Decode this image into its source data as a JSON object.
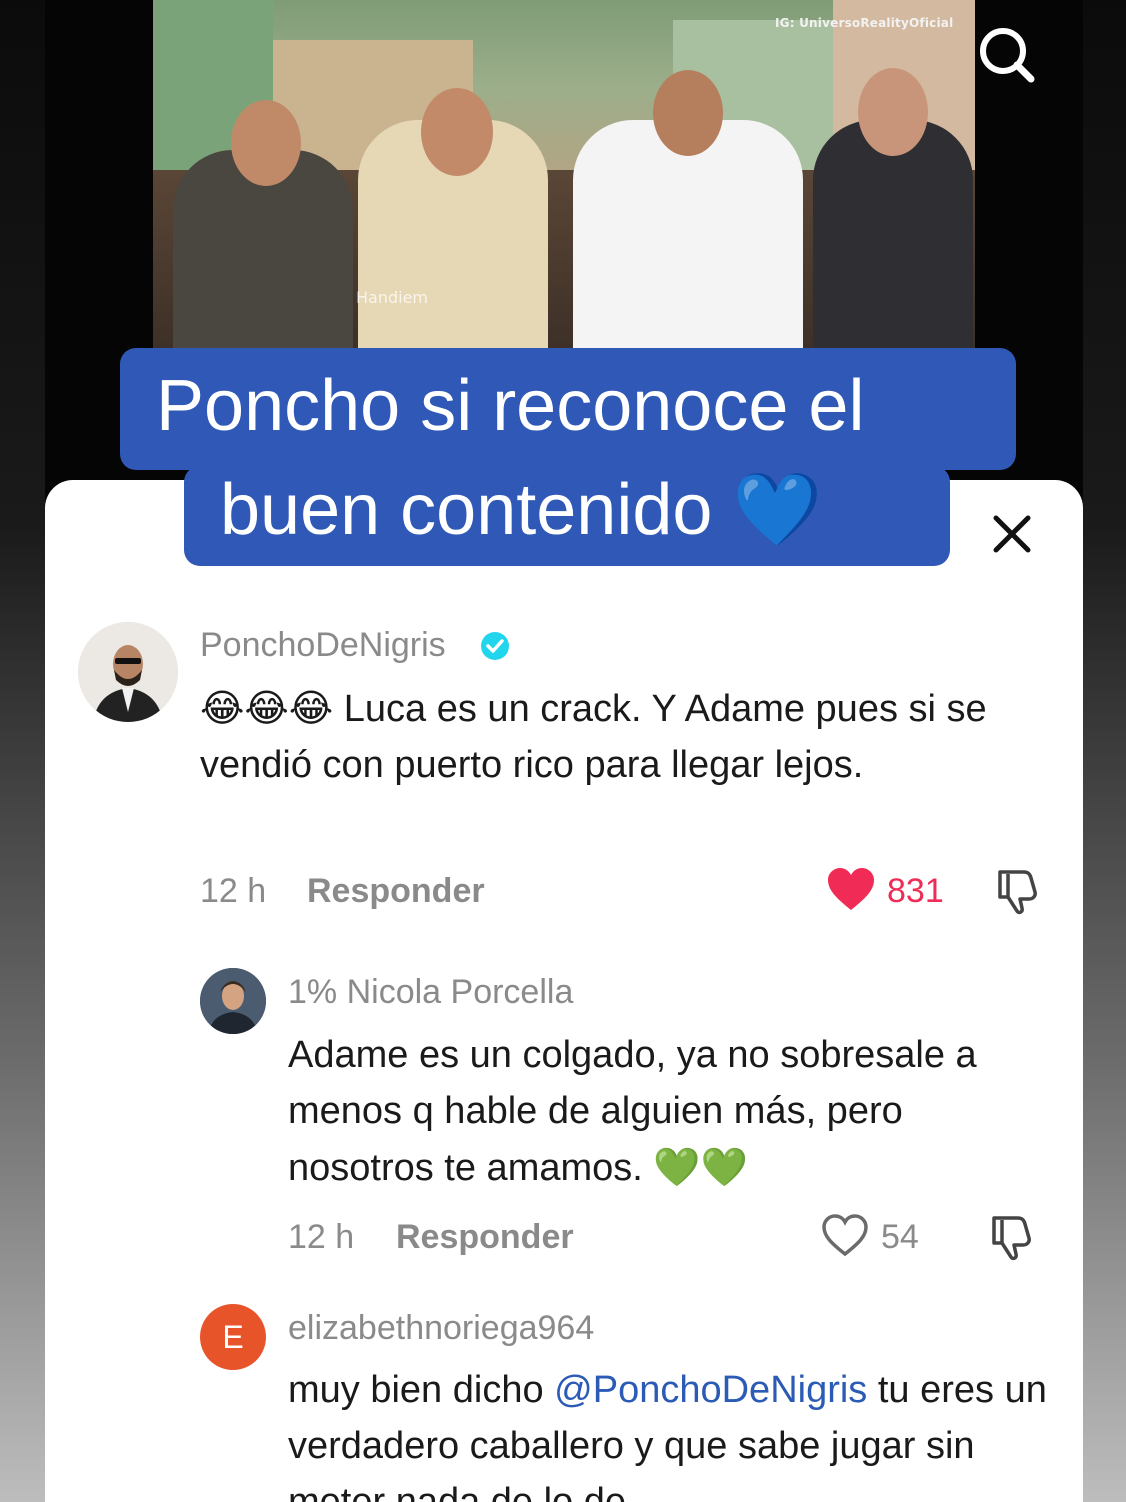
{
  "video": {
    "watermark": "IG: UniversoRealityOficial",
    "overlay_mark": "Handiem",
    "caption_line1": "Poncho si reconoce el",
    "caption_line2": "buen contenido 💙",
    "caption_color": "#2f58b7"
  },
  "icons": {
    "search": "search-icon",
    "close": "close-icon",
    "like": "heart-icon",
    "dislike": "thumbs-down-icon",
    "verified": "verified-badge-icon"
  },
  "comments": [
    {
      "username": "PonchoDeNigris",
      "verified": true,
      "emoji": "😂😂😂",
      "text": "Luca es un crack. Y Adame pues si se vendió con puerto rico para llegar lejos.",
      "time": "12 h",
      "reply_label": "Responder",
      "likes": "831",
      "liked": true
    },
    {
      "username": "1% Nicola Porcella",
      "text": "Adame es un colgado, ya no sobresale a menos q hable de alguien más, pero nosotros te amamos.",
      "emoji_suffix": "💚💚",
      "time": "12 h",
      "reply_label": "Responder",
      "likes": "54",
      "liked": false
    },
    {
      "username": "elizabethnoriega964",
      "avatar_letter": "E",
      "avatar_color": "#e8542a",
      "text_before": "muy bien dicho ",
      "mention": "@PonchoDeNigris",
      "text_after": " tu eres un verdadero caballero y que sabe jugar sin meter nada de lo de"
    }
  ],
  "colors": {
    "liked_heart": "#f02c56",
    "meta_gray": "#8a8a8a",
    "mention_blue": "#2b5bb5"
  }
}
